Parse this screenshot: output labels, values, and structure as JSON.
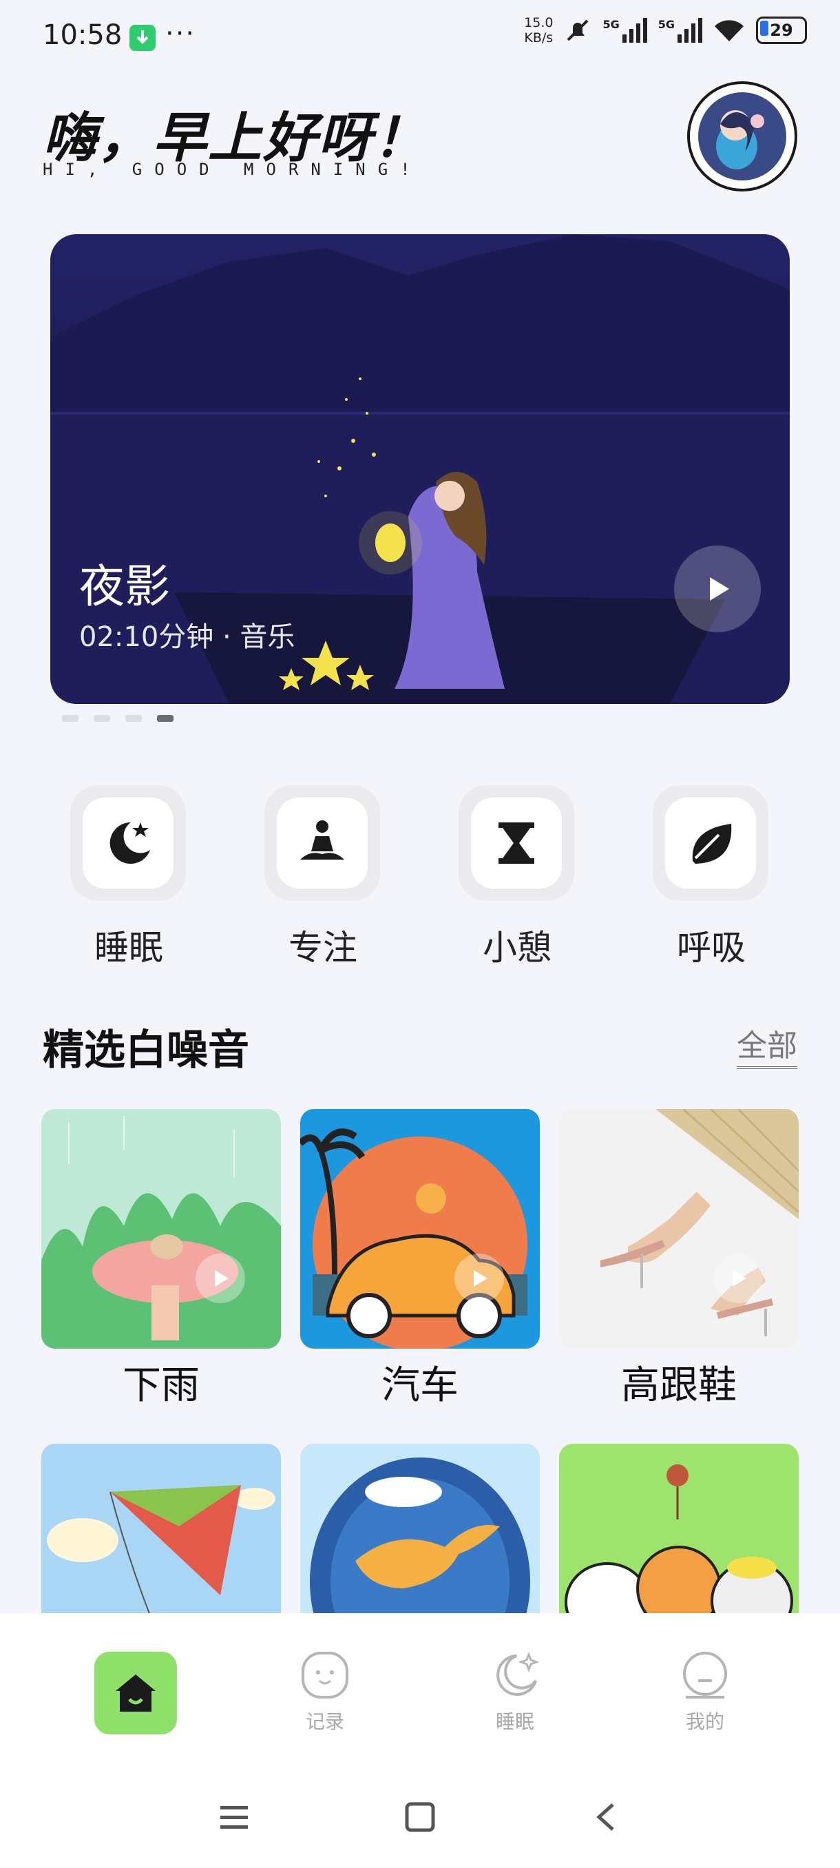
{
  "status_bar": {
    "time": "10:58",
    "dots": "···",
    "net_speed_value": "15.0",
    "net_speed_unit": "KB/s",
    "signal1": "5G",
    "signal2": "5G",
    "battery": "29"
  },
  "header": {
    "title": "嗨，早上好呀！",
    "subtitle": "HI, GOOD MORNING!"
  },
  "banner": {
    "title": "夜影",
    "meta": "02:10分钟 · 音乐",
    "page_count": 4,
    "active_page": 4
  },
  "categories": [
    {
      "label": "睡眠",
      "icon": "moon-star-icon"
    },
    {
      "label": "专注",
      "icon": "meditation-icon"
    },
    {
      "label": "小憩",
      "icon": "hourglass-icon"
    },
    {
      "label": "呼吸",
      "icon": "leaf-icon"
    }
  ],
  "section": {
    "title": "精选白噪音",
    "more": "全部"
  },
  "tiles": [
    {
      "label": "下雨",
      "image": "rain-mushroom"
    },
    {
      "label": "汽车",
      "image": "orange-beetle-car"
    },
    {
      "label": "高跟鞋",
      "image": "high-heels"
    },
    {
      "label": "",
      "image": "kite"
    },
    {
      "label": "",
      "image": "bird"
    },
    {
      "label": "",
      "image": "cats"
    }
  ],
  "bottom_nav": {
    "items": [
      {
        "label": "",
        "icon": "home-icon",
        "active": true
      },
      {
        "label": "记录",
        "icon": "face-icon"
      },
      {
        "label": "睡眠",
        "icon": "moon-sparkle-icon"
      },
      {
        "label": "我的",
        "icon": "profile-icon"
      }
    ]
  },
  "colors": {
    "accent_green": "#8fe06a",
    "background": "#f4f5fa",
    "banner_night": "#1e1b4f"
  }
}
